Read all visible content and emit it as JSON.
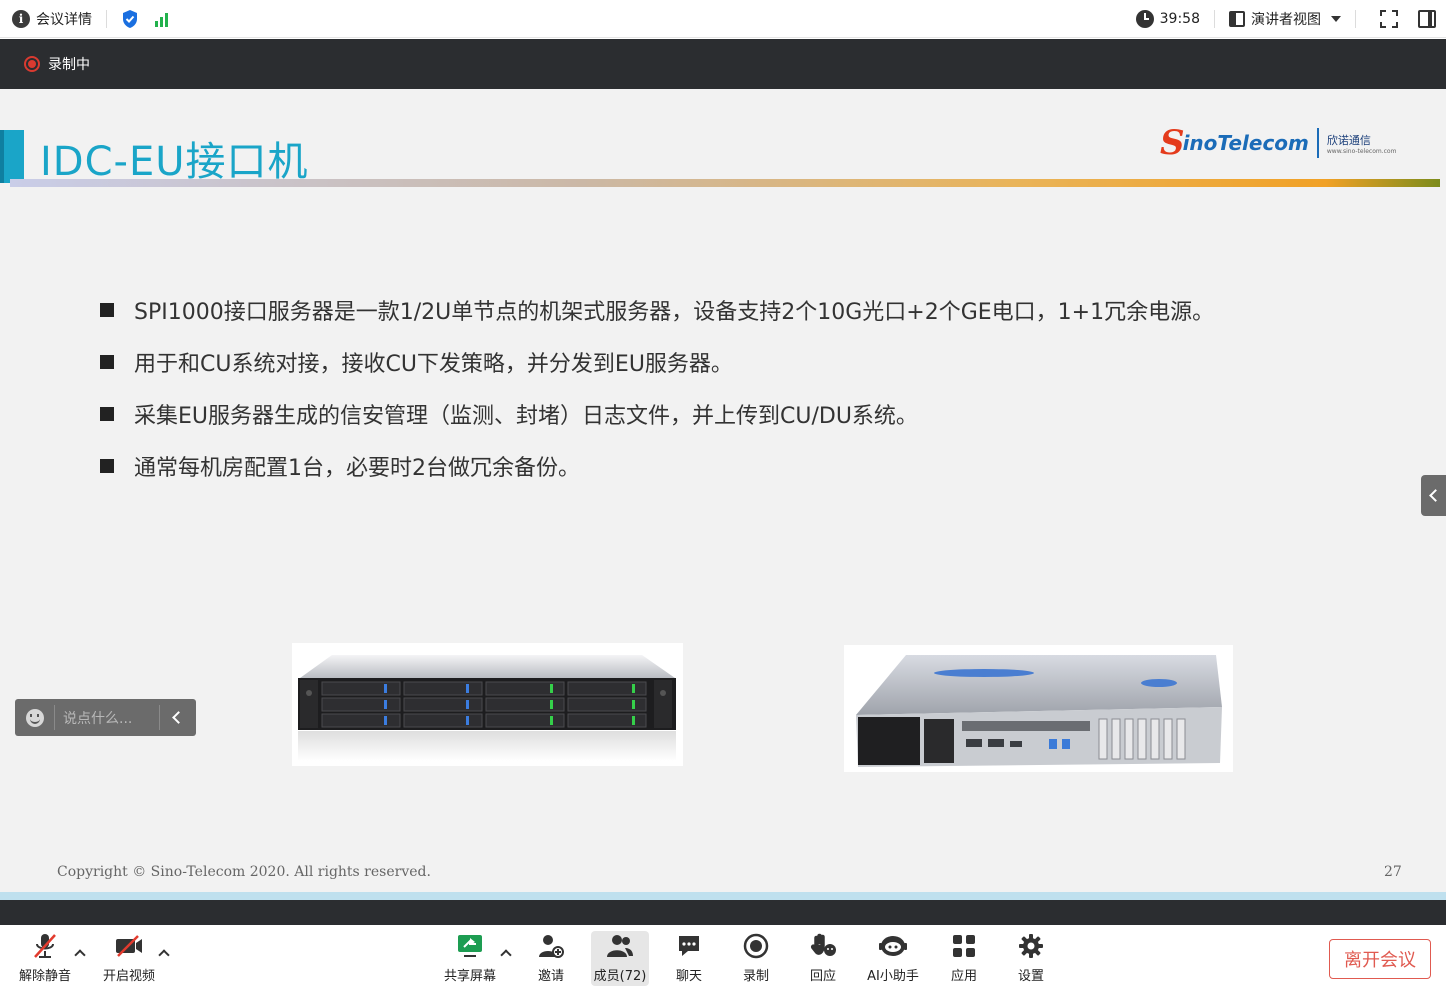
{
  "top_bar": {
    "meeting_details": "会议详情",
    "timer": "39:58",
    "view_mode": "演讲者视图"
  },
  "recording": {
    "status": "录制中"
  },
  "slide": {
    "title": "IDC-EU接口机",
    "logo_latin": "inoTelecom",
    "logo_s": "S",
    "logo_cn": "欣诺通信",
    "logo_url": "www.sino-telecom.com",
    "bullets": [
      "SPI1000接口服务器是一款1/2U单节点的机架式服务器，设备支持2个10G光口+2个GE电口，1+1冗余电源。",
      "用于和CU系统对接，接收CU下发策略，并分发到EU服务器。",
      "采集EU服务器生成的信安管理（监测、封堵）日志文件，并上传到CU/DU系统。",
      "通常每机房配置1台，必要时2台做冗余备份。"
    ],
    "copyright": "Copyright © Sino-Telecom 2020. All rights reserved.",
    "page_number": "27",
    "colors": {
      "title": "#1aa5c8",
      "accent": "#f1a126"
    }
  },
  "chat": {
    "placeholder": "说点什么..."
  },
  "toolbar": {
    "unmute": "解除静音",
    "start_video": "开启视频",
    "share_screen": "共享屏幕",
    "invite": "邀请",
    "members": "成员(72)",
    "chat": "聊天",
    "record": "录制",
    "react": "回应",
    "ai_assistant": "AI小助手",
    "apps": "应用",
    "settings": "设置",
    "leave": "离开会议"
  }
}
